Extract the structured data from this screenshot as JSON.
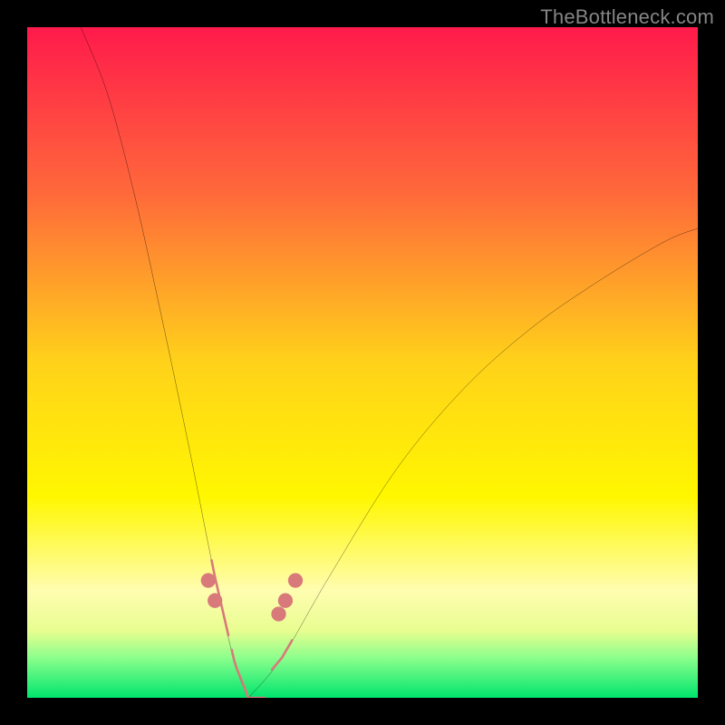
{
  "watermark": "TheBottleneck.com",
  "chart_data": {
    "type": "line",
    "title": "",
    "xlabel": "",
    "ylabel": "",
    "xlim": [
      0,
      100
    ],
    "ylim": [
      0,
      100
    ],
    "grid": false,
    "legend": false,
    "background_gradient": {
      "stops": [
        {
          "pct": 0,
          "color": "#ff1a4b"
        },
        {
          "pct": 25,
          "color": "#ff6a3a"
        },
        {
          "pct": 50,
          "color": "#ffd21a"
        },
        {
          "pct": 70,
          "color": "#fff700"
        },
        {
          "pct": 84,
          "color": "#fffdb0"
        },
        {
          "pct": 90,
          "color": "#e8fd90"
        },
        {
          "pct": 94,
          "color": "#8cff8c"
        },
        {
          "pct": 100,
          "color": "#00e56e"
        }
      ]
    },
    "curve": {
      "type": "v-curve",
      "x_min_at": 33,
      "left_branch": [
        {
          "x": 8,
          "y": 100
        },
        {
          "x": 12,
          "y": 90
        },
        {
          "x": 16,
          "y": 75
        },
        {
          "x": 20,
          "y": 57
        },
        {
          "x": 24,
          "y": 38
        },
        {
          "x": 28,
          "y": 18
        },
        {
          "x": 31,
          "y": 5
        },
        {
          "x": 33,
          "y": 0
        }
      ],
      "right_branch": [
        {
          "x": 33,
          "y": 0
        },
        {
          "x": 38,
          "y": 6
        },
        {
          "x": 45,
          "y": 18
        },
        {
          "x": 55,
          "y": 34
        },
        {
          "x": 65,
          "y": 46
        },
        {
          "x": 75,
          "y": 55
        },
        {
          "x": 85,
          "y": 62
        },
        {
          "x": 95,
          "y": 68
        },
        {
          "x": 100,
          "y": 70
        }
      ]
    },
    "bottom_highlight": {
      "stroke_color": "#d87a7a",
      "segments": [
        {
          "side": "left",
          "x_start": 27.5,
          "x_end": 30.0
        },
        {
          "side": "left",
          "x_start": 30.5,
          "x_end": 35.5
        },
        {
          "side": "right",
          "x_start": 36.5,
          "x_end": 39.5
        }
      ],
      "dots": [
        {
          "x": 27.0,
          "y": 17.5
        },
        {
          "x": 28.0,
          "y": 14.5
        },
        {
          "x": 37.5,
          "y": 12.5
        },
        {
          "x": 38.5,
          "y": 14.5
        },
        {
          "x": 40.0,
          "y": 17.5
        }
      ]
    }
  }
}
